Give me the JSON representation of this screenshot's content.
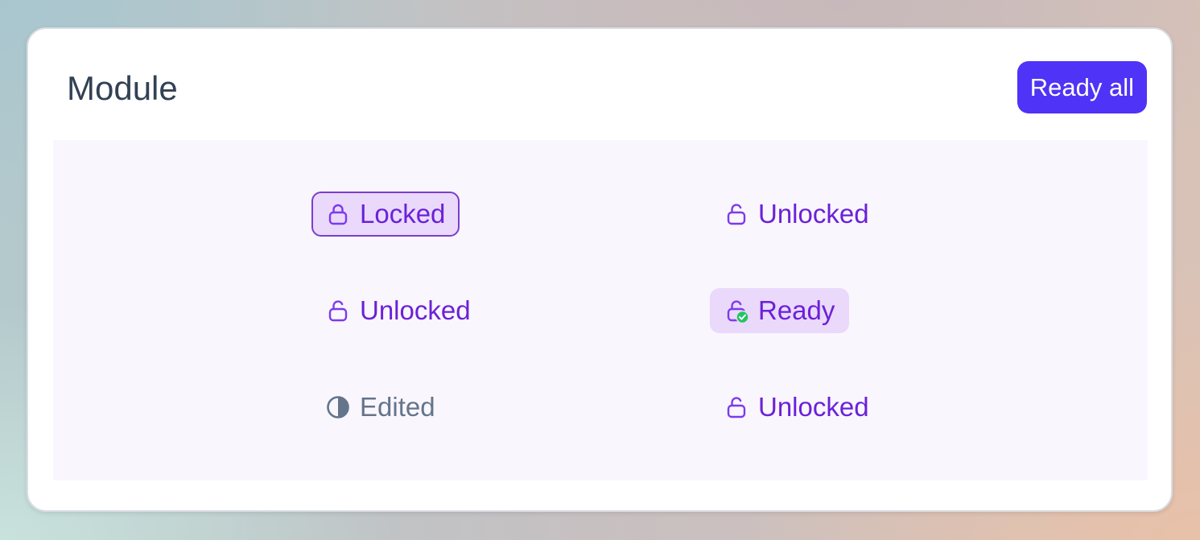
{
  "module": {
    "title": "Module",
    "ready_all_label": "Ready all"
  },
  "items": [
    {
      "label": "Locked",
      "icon": "lock-icon",
      "state": "locked",
      "selected": true
    },
    {
      "label": "Unlocked",
      "icon": "unlock-icon",
      "state": "unlocked"
    },
    {
      "label": "Unlocked",
      "icon": "unlock-icon",
      "state": "unlocked"
    },
    {
      "label": "Ready",
      "icon": "unlock-check-icon",
      "state": "ready"
    },
    {
      "label": "Edited",
      "icon": "half-circle-icon",
      "state": "edited"
    },
    {
      "label": "Unlocked",
      "icon": "unlock-icon",
      "state": "unlocked"
    }
  ],
  "colors": {
    "accent": "#4f33f6",
    "status_text": "#6b21d8",
    "edited_text": "#64748b",
    "chip_highlight": "#ead9fb",
    "ready_check": "#22c55e",
    "panel_background": "#f9f6fd"
  }
}
